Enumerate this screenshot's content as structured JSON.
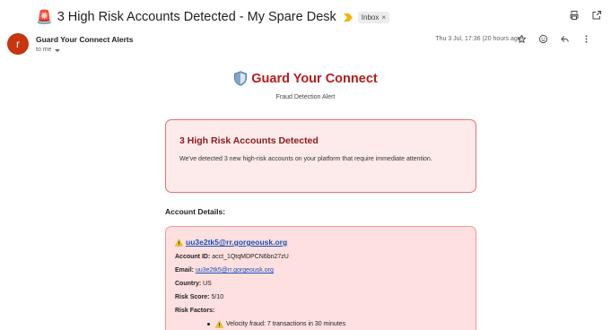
{
  "header": {
    "subject": "3 High Risk Accounts Detected - My Spare Desk",
    "label_chip": "Inbox",
    "label_chip_close": "×",
    "importance_color": "#f4b400"
  },
  "sender": {
    "avatar_letter": "r",
    "avatar_color": "#c8350f",
    "name": "Guard Your Connect Alerts",
    "to": "to me",
    "date": "Thu 3 Jul, 17:36 (20 hours ago)"
  },
  "email": {
    "brand_title": "Guard Your Connect",
    "brand_subtitle": "Fraud Detection Alert",
    "alert_title": "3 High Risk Accounts Detected",
    "alert_text": "We've detected 3 new high-risk accounts on your platform that require immediate attention.",
    "section_title": "Account Details:",
    "account": {
      "email_link": "uu3e2tk5@rr.gorgeousk.org",
      "account_id_label": "Account ID:",
      "account_id": "acct_1QtqMDPCN6bn27zU",
      "email_label": "Email:",
      "email": "uu3e2tk5@rr.gorgeousk.org",
      "country_label": "Country:",
      "country": "US",
      "risk_score_label": "Risk Score:",
      "risk_score": "5/10",
      "risk_factors_label": "Risk Factors:",
      "risk_factors": [
        "Velocity fraud: 7 transactions in 30 minutes"
      ]
    }
  },
  "colors": {
    "brand_red": "#b71c1c",
    "alert_bg": "#fdeaea",
    "alert_border": "#e57373",
    "card_bg": "#fde0df",
    "link_blue": "#1a4fb5"
  }
}
